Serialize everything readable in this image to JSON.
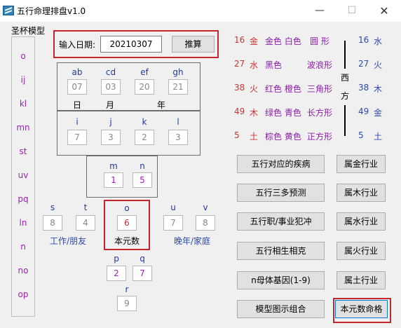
{
  "window": {
    "title": "五行命理排盘v1.0",
    "min": "—",
    "max": "☐",
    "close": "✕"
  },
  "group": {
    "title": "圣杯模型",
    "labels": [
      "o",
      "ij",
      "kl",
      "mn",
      "st",
      "uv",
      "pq",
      "ln",
      "n",
      "no",
      "op"
    ]
  },
  "date": {
    "label": "输入日期:",
    "value": "20210307",
    "button": "推算"
  },
  "chart": {
    "row1_labels": [
      "ab",
      "cd",
      "ef",
      "gh"
    ],
    "row1_values": [
      "07",
      "03",
      "20",
      "21"
    ],
    "row1_captions": [
      "日",
      "月",
      "年"
    ],
    "row2_labels": [
      "i",
      "j",
      "k",
      "l"
    ],
    "row2_values": [
      "7",
      "3",
      "2",
      "3"
    ],
    "mn_labels": [
      "m",
      "n"
    ],
    "mn_values": [
      "1",
      "5"
    ],
    "side_left_labels": [
      "s",
      "t"
    ],
    "side_left_values": [
      "8",
      "4"
    ],
    "side_left_caption": "工作/朋友",
    "center_label": "o",
    "center_value": "6",
    "center_caption": "本元数",
    "side_right_labels": [
      "u",
      "v"
    ],
    "side_right_values": [
      "7",
      "8"
    ],
    "side_right_caption": "晚年/家庭",
    "pq_labels": [
      "p",
      "q"
    ],
    "pq_values": [
      "2",
      "7"
    ],
    "r_label": "r",
    "r_value": "9"
  },
  "legend": {
    "left_rows": [
      {
        "num": "16",
        "el": "金",
        "colors": "金色 白色",
        "shape": "圆  形"
      },
      {
        "num": "27",
        "el": "水",
        "colors": "黑色",
        "shape": "波浪形"
      },
      {
        "num": "38",
        "el": "火",
        "colors": "红色 橙色",
        "shape": "三角形"
      },
      {
        "num": "49",
        "el": "木",
        "colors": "绿色 青色",
        "shape": "长方形"
      },
      {
        "num": "5",
        "el": "土",
        "colors": "棕色 黄色",
        "shape": "正方形"
      }
    ],
    "direction": [
      "西",
      "方"
    ],
    "right_rows": [
      {
        "num": "16",
        "el": "水"
      },
      {
        "num": "27",
        "el": "火"
      },
      {
        "num": "38",
        "el": "木"
      },
      {
        "num": "49",
        "el": "金"
      },
      {
        "num": "5",
        "el": "土"
      }
    ]
  },
  "buttons": {
    "left": [
      "五行对应的疾病",
      "五行三多预测",
      "五行职/事业犯冲",
      "五行相生相克",
      "n母体基因(1-9)",
      "模型图示组合"
    ],
    "right": [
      "属金行业",
      "属木行业",
      "属水行业",
      "属火行业",
      "属土行业",
      "本元数命格"
    ]
  }
}
